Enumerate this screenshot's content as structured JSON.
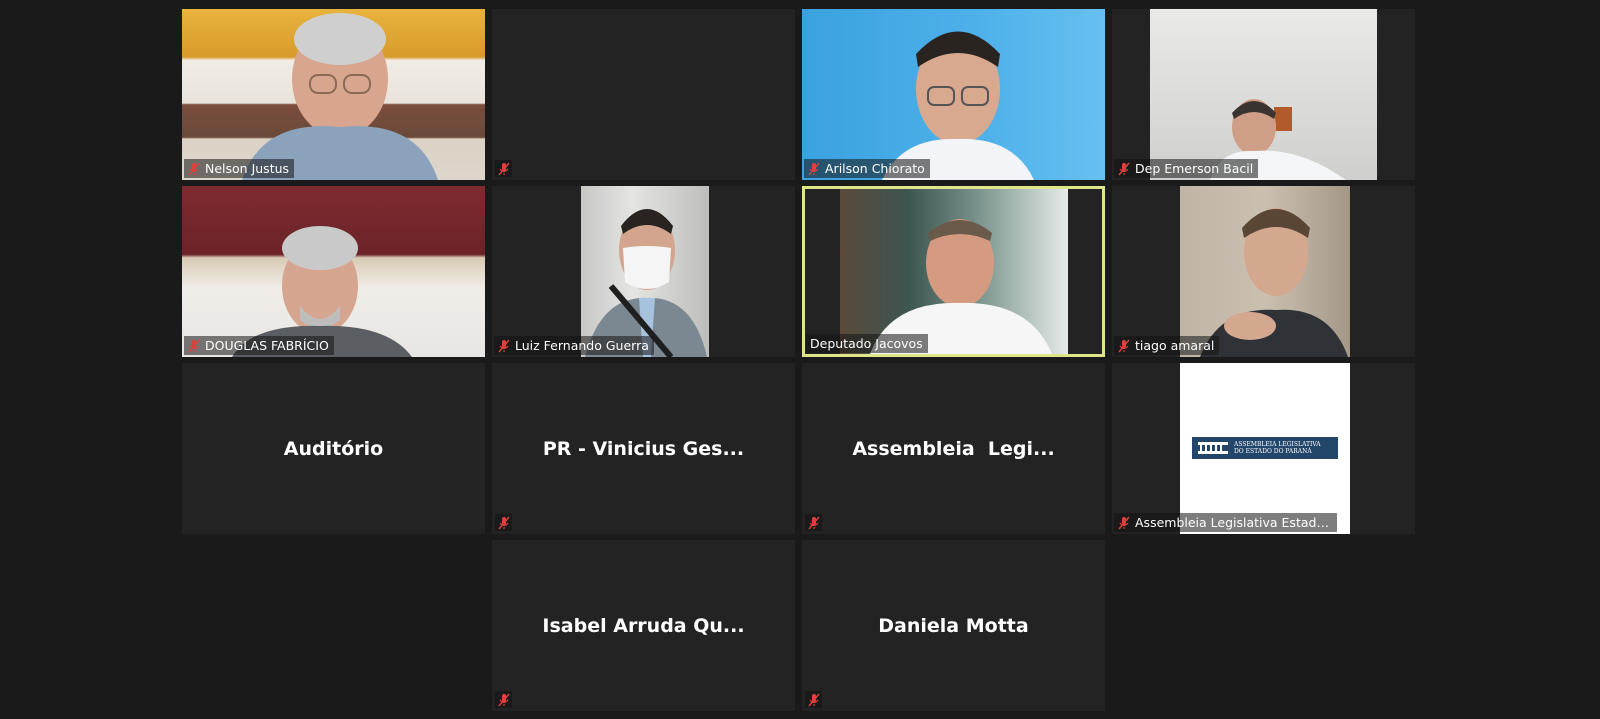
{
  "colors": {
    "background": "#1a1a1a",
    "tile_background": "#232323",
    "active_speaker_border": "#dfe58a",
    "muted_icon": "#e0403c"
  },
  "tiles": [
    {
      "name": "Nelson Justus",
      "muted": true,
      "video": true
    },
    {
      "name": "",
      "muted": true,
      "video": false
    },
    {
      "name": "Arilson Chiorato",
      "muted": true,
      "video": true
    },
    {
      "name": "Dep Emerson Bacil",
      "muted": true,
      "video": true
    },
    {
      "name": "DOUGLAS FABRÍCIO",
      "muted": true,
      "video": true
    },
    {
      "name": "Luiz Fernando Guerra",
      "muted": true,
      "video": true
    },
    {
      "name": "Deputado Jacovos",
      "muted": false,
      "video": true,
      "active_speaker": true
    },
    {
      "name": "tiago amaral",
      "muted": true,
      "video": true
    },
    {
      "name": "Auditório",
      "muted": false,
      "video": false
    },
    {
      "name": "PR - Vinicius Ges...",
      "muted": true,
      "video": false
    },
    {
      "name": "Assembleia  Legi...",
      "muted": true,
      "video": false
    },
    {
      "name": "Assembleia Legislativa Estado ...",
      "muted": true,
      "video": true
    },
    {
      "name": "Isabel Arruda Qu...",
      "muted": true,
      "video": false
    },
    {
      "name": "Daniela Motta",
      "muted": true,
      "video": false
    }
  ],
  "logo": {
    "line1": "ASSEMBLEIA LEGISLATIVA",
    "line2": "DO ESTADO DO PARANÁ"
  },
  "icons": {
    "muted": "microphone-muted-icon"
  }
}
